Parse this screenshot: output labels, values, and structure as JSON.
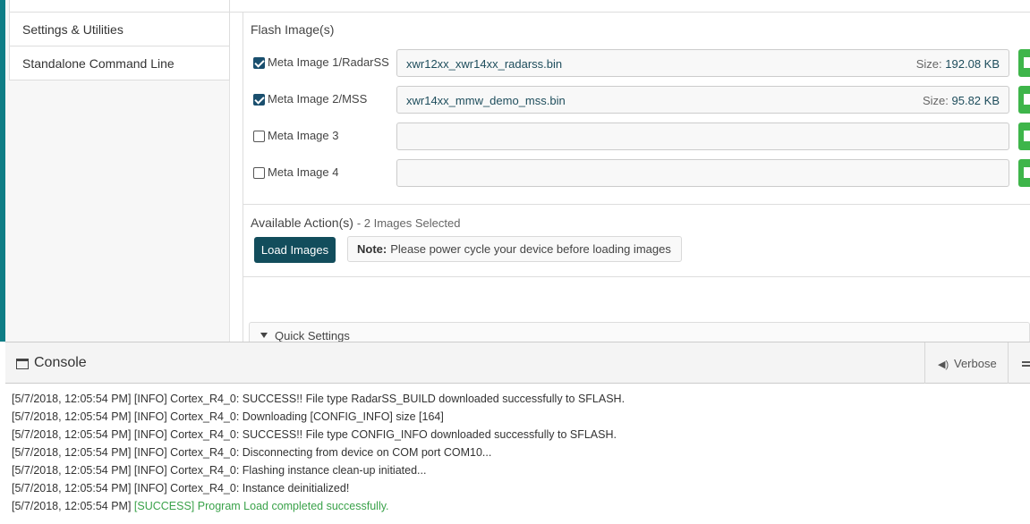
{
  "sidebar": {
    "items": [
      {
        "label": ""
      },
      {
        "label": "Settings & Utilities"
      },
      {
        "label": "Standalone Command Line"
      }
    ]
  },
  "flash": {
    "title": "Flash Image(s)",
    "size_prefix": "Size:",
    "images": [
      {
        "label": "Meta Image 1/RadarSS",
        "checked": true,
        "file": "xwr12xx_xwr14xx_radarss.bin",
        "size": "192.08 KB"
      },
      {
        "label": "Meta Image 2/MSS",
        "checked": true,
        "file": "xwr14xx_mmw_demo_mss.bin",
        "size": "95.82 KB"
      },
      {
        "label": "Meta Image 3",
        "checked": false,
        "file": "",
        "size": ""
      },
      {
        "label": "Meta Image 4",
        "checked": false,
        "file": "",
        "size": ""
      }
    ]
  },
  "actions": {
    "title": "Available Action(s)",
    "count": "- 2 Images Selected",
    "load_button": "Load Images",
    "note_label": "Note:",
    "note_text": "Please power cycle your device before loading images"
  },
  "quick_settings": {
    "label": "Quick Settings"
  },
  "console": {
    "title": "Console",
    "verbose_label": "Verbose",
    "lines": [
      {
        "text": "[5/7/2018, 12:05:54 PM] [INFO] Cortex_R4_0: SUCCESS!! File type RadarSS_BUILD downloaded successfully to SFLASH.",
        "success": ""
      },
      {
        "text": "[5/7/2018, 12:05:54 PM] [INFO] Cortex_R4_0: Downloading [CONFIG_INFO] size [164]",
        "success": ""
      },
      {
        "text": "[5/7/2018, 12:05:54 PM] [INFO] Cortex_R4_0: SUCCESS!! File type CONFIG_INFO downloaded successfully to SFLASH.",
        "success": ""
      },
      {
        "text": "[5/7/2018, 12:05:54 PM] [INFO] Cortex_R4_0: Disconnecting from device on COM port COM10...",
        "success": ""
      },
      {
        "text": "[5/7/2018, 12:05:54 PM] [INFO] Cortex_R4_0: Flashing instance clean-up initiated...",
        "success": ""
      },
      {
        "text": "[5/7/2018, 12:05:54 PM] [INFO] Cortex_R4_0: Instance deinitialized!",
        "success": ""
      },
      {
        "text": "[5/7/2018, 12:05:54 PM] ",
        "success": "[SUCCESS] Program Load completed successfully."
      }
    ]
  },
  "colors": {
    "accent": "#0f7e86",
    "primary_button": "#124d5c",
    "browse_button": "#3eb54a",
    "success_text": "#3aa24a"
  },
  "icons": {
    "browse": "folder-icon",
    "console": "window-icon",
    "verbose": "speaker-icon",
    "menu": "menu-icon",
    "quick_caret": "caret-down-icon"
  }
}
